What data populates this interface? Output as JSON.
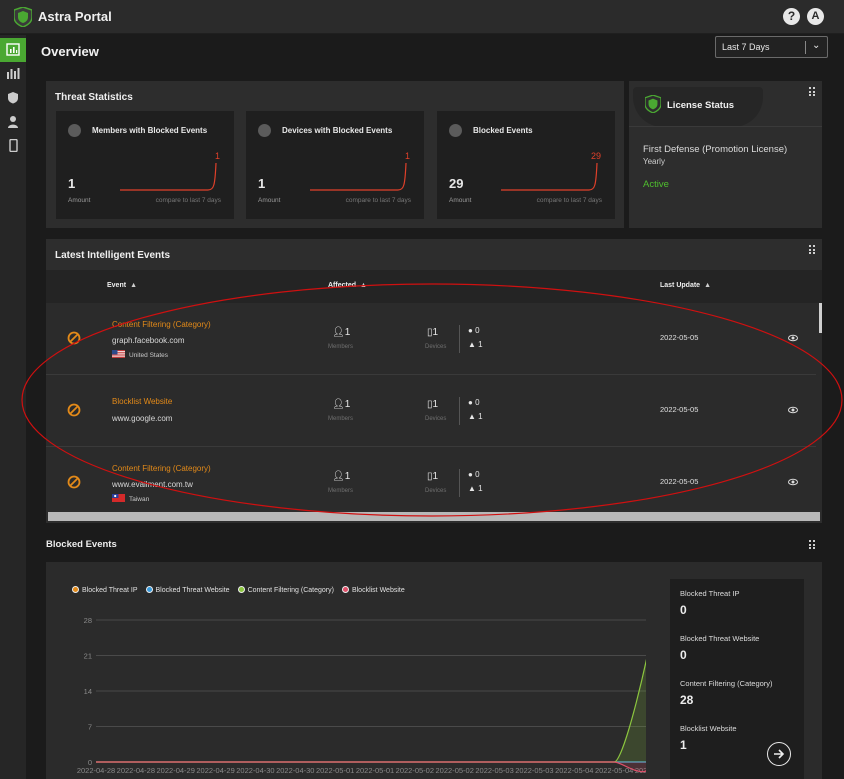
{
  "app": {
    "title": "Astra Portal",
    "help": "?",
    "user_initial": "A"
  },
  "header": {
    "page_title": "Overview",
    "range_select": "Last 7 Days"
  },
  "sidebar": {
    "items": [
      "dashboard-icon",
      "reports-icon",
      "shield-icon",
      "members-icon",
      "devices-icon"
    ],
    "active": 0
  },
  "threat_stats": {
    "title": "Threat Statistics",
    "cards": [
      {
        "label": "Members with Blocked Events",
        "amount": "1",
        "spark_value": "1",
        "amount_label": "Amount",
        "compare_label": "compare to last 7 days"
      },
      {
        "label": "Devices with Blocked Events",
        "amount": "1",
        "spark_value": "1",
        "amount_label": "Amount",
        "compare_label": "compare to last 7 days"
      },
      {
        "label": "Blocked Events",
        "amount": "29",
        "spark_value": "29",
        "amount_label": "Amount",
        "compare_label": "compare to last 7 days"
      }
    ]
  },
  "license": {
    "title": "License Status",
    "name": "First Defense (Promotion License)",
    "term": "Yearly",
    "status": "Active",
    "status_color": "#4fbf2e"
  },
  "events": {
    "title": "Latest Intelligent Events",
    "columns": {
      "event": "Event",
      "affected": "Affected",
      "last_update": "Last Update"
    },
    "rows": [
      {
        "category": "Content Filtering (Category)",
        "host": "graph.facebook.com",
        "country": "United States",
        "members": "1",
        "members_label": "Members",
        "devices": "1",
        "devices_label": "Devices",
        "ios": "0",
        "android": "1",
        "date": "2022-05-05"
      },
      {
        "category": "Blocklist Website",
        "host": "www.google.com",
        "country": "",
        "members": "1",
        "members_label": "Members",
        "devices": "1",
        "devices_label": "Devices",
        "ios": "0",
        "android": "1",
        "date": "2022-05-05"
      },
      {
        "category": "Content Filtering (Category)",
        "host": "www.evailment.com.tw",
        "country": "Taiwan",
        "members": "1",
        "members_label": "Members",
        "devices": "1",
        "devices_label": "Devices",
        "ios": "0",
        "android": "1",
        "date": "2022-05-05"
      }
    ]
  },
  "blocked_events": {
    "title": "Blocked Events",
    "summary": [
      {
        "label": "Blocked Threat IP",
        "value": "0"
      },
      {
        "label": "Blocked Threat Website",
        "value": "0"
      },
      {
        "label": "Content Filtering (Category)",
        "value": "28"
      },
      {
        "label": "Blocklist Website",
        "value": "1"
      }
    ]
  },
  "colors": {
    "accent": "#4aa832",
    "event_category": "#e38a19",
    "spark": "#e0402a",
    "annotation": "#d01010"
  },
  "chart_data": {
    "type": "area",
    "x": [
      "2022-04-28",
      "2022-04-28",
      "2022-04-29",
      "2022-04-29",
      "2022-04-30",
      "2022-04-30",
      "2022-05-01",
      "2022-05-01",
      "2022-05-02",
      "2022-05-02",
      "2022-05-03",
      "2022-05-03",
      "2022-05-04",
      "2022-05-04",
      "2022-05-05"
    ],
    "yticks": [
      0,
      7,
      14,
      21,
      28
    ],
    "ylim": [
      0,
      28
    ],
    "grid": true,
    "legend": "top-left",
    "series": [
      {
        "name": "Blocked Threat IP",
        "color": "#e38a19",
        "values": [
          0,
          0,
          0,
          0,
          0,
          0,
          0,
          0,
          0,
          0,
          0,
          0,
          0,
          0,
          0
        ]
      },
      {
        "name": "Blocked Threat Website",
        "color": "#3a9bdc",
        "values": [
          0,
          0,
          0,
          0,
          0,
          0,
          0,
          0,
          0,
          0,
          0,
          0,
          0,
          0,
          0
        ]
      },
      {
        "name": "Content Filtering (Category)",
        "color": "#8cc63f",
        "values": [
          0,
          0,
          0,
          0,
          0,
          0,
          0,
          0,
          0,
          0,
          0,
          0,
          0,
          0,
          28
        ]
      },
      {
        "name": "Blocklist Website",
        "color": "#e0506a",
        "values": [
          0,
          0,
          0,
          0,
          0,
          0,
          0,
          0,
          0,
          0,
          0,
          0,
          0,
          0,
          1
        ]
      }
    ]
  }
}
